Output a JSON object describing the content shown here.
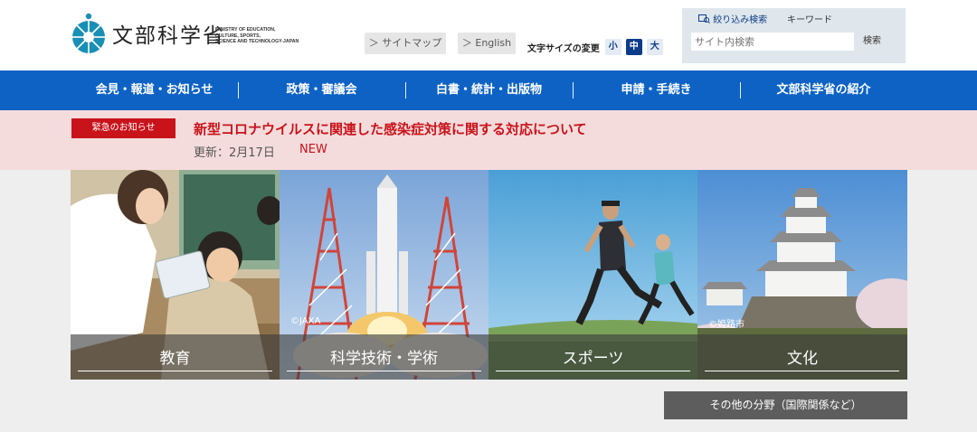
{
  "header": {
    "logo_name": "文部科学省",
    "logo_english": [
      "MINISTRY OF EDUCATION,",
      "CULTURE, SPORTS,",
      "SCIENCE AND TECHNOLOGY-JAPAN"
    ],
    "sitemap": "＞ サイトマップ",
    "english": "＞ English",
    "font_size_label": "文字サイズの変更",
    "font_sizes": [
      "小",
      "中",
      "大"
    ],
    "font_size_selected": "中",
    "search": {
      "tab_narrow": "絞り込み検索",
      "tab_keyword": "キーワード",
      "placeholder": "サイト内検索",
      "button": "検索"
    }
  },
  "nav": [
    "会見・報道・お知らせ",
    "政策・審議会",
    "白書・統計・出版物",
    "申請・手続き",
    "文部科学省の紹介"
  ],
  "emergency": {
    "badge": "緊急のお知らせ",
    "title": "新型コロナウイルスに関連した感染症対策に関する対応について",
    "date": "更新：2月17日",
    "new": "NEW"
  },
  "tiles": [
    {
      "label": "教育",
      "credit": ""
    },
    {
      "label": "科学技術・学術",
      "credit": "©JAXA"
    },
    {
      "label": "スポーツ",
      "credit": ""
    },
    {
      "label": "文化",
      "credit": "©姫路市"
    }
  ],
  "other_fields": "その他の分野（国際関係など）",
  "colors": {
    "nav_blue": "#0d62c4",
    "alert_red": "#c8131b",
    "alert_bg": "#f5dcdc",
    "logo_blue": "#1a8fb5"
  }
}
